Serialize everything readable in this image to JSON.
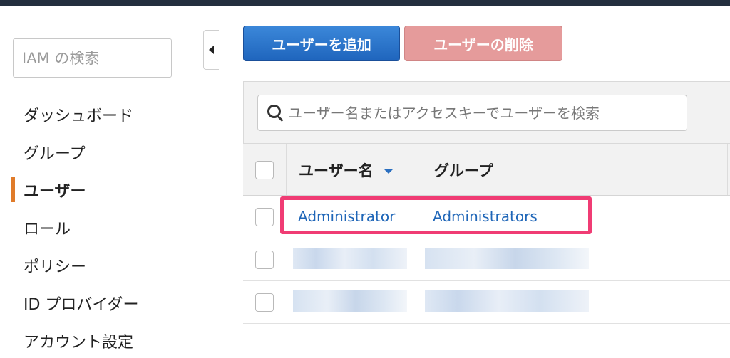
{
  "sidebar": {
    "search_placeholder": "IAM の検索",
    "items": [
      {
        "label": "ダッシュボード",
        "active": false
      },
      {
        "label": "グループ",
        "active": false
      },
      {
        "label": "ユーザー",
        "active": true
      },
      {
        "label": "ロール",
        "active": false
      },
      {
        "label": "ポリシー",
        "active": false
      },
      {
        "label": "ID プロバイダー",
        "active": false
      },
      {
        "label": "アカウント設定",
        "active": false
      }
    ]
  },
  "toolbar": {
    "add_user_label": "ユーザーを追加",
    "delete_user_label": "ユーザーの削除"
  },
  "filter": {
    "placeholder": "ユーザー名またはアクセスキーでユーザーを検索"
  },
  "table": {
    "columns": [
      "ユーザー名",
      "グループ"
    ],
    "rows": [
      {
        "user": "Administrator",
        "group": "Administrators"
      }
    ]
  },
  "colors": {
    "primary_button": "#2a72c9",
    "danger_button_disabled": "#e59b9b",
    "link": "#1f66b8",
    "highlight": "#f03c74",
    "active_nav_marker": "#e07b2a",
    "topbar": "#232f3e"
  }
}
